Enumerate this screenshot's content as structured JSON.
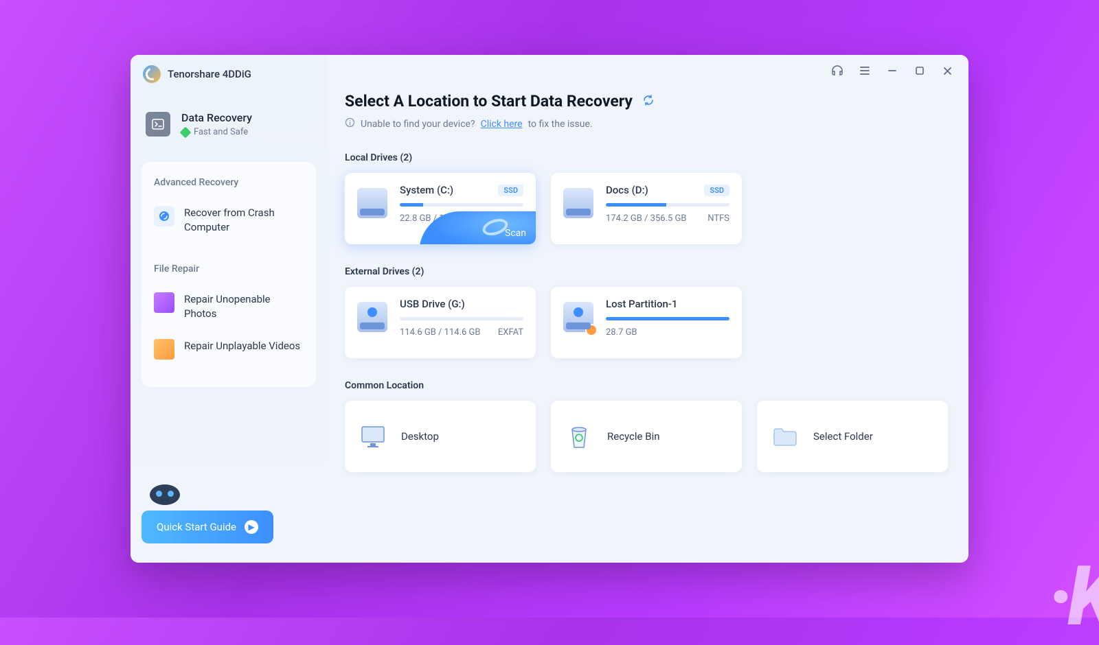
{
  "app": {
    "title": "Tenorshare 4DDiG"
  },
  "sidebar": {
    "primary": {
      "title": "Data Recovery",
      "subtitle": "Fast and Safe"
    },
    "advanced_label": "Advanced Recovery",
    "advanced_items": [
      {
        "label": "Recover from Crash Computer"
      }
    ],
    "repair_label": "File Repair",
    "repair_items": [
      {
        "label": "Repair Unopenable Photos"
      },
      {
        "label": "Repair Unplayable Videos"
      }
    ],
    "quick_start": "Quick Start Guide"
  },
  "main": {
    "title": "Select A Location to Start Data Recovery",
    "hint_prefix": "Unable to find your device?",
    "hint_link": "Click here",
    "hint_suffix": "to fix the issue.",
    "scan_label": "Scan",
    "sections": {
      "local": {
        "label": "Local Drives (2)"
      },
      "external": {
        "label": "External Drives (2)"
      },
      "common": {
        "label": "Common Location"
      }
    },
    "local_drives": [
      {
        "name": "System (C:)",
        "badge": "SSD",
        "used_pct": 19,
        "meta": "22.8 GB / 120.0 GB",
        "fs": "",
        "selected": true
      },
      {
        "name": "Docs (D:)",
        "badge": "SSD",
        "used_pct": 49,
        "meta": "174.2 GB / 356.5 GB",
        "fs": "NTFS",
        "selected": false
      }
    ],
    "external_drives": [
      {
        "name": "USB Drive (G:)",
        "badge": "",
        "used_pct": 0,
        "meta": "114.6 GB / 114.6 GB",
        "fs": "EXFAT",
        "lost": false
      },
      {
        "name": "Lost Partition-1",
        "badge": "",
        "used_pct": 100,
        "meta": "28.7 GB",
        "fs": "",
        "lost": true
      }
    ],
    "common_locations": [
      {
        "label": "Desktop"
      },
      {
        "label": "Recycle Bin"
      },
      {
        "label": "Select Folder"
      }
    ]
  }
}
